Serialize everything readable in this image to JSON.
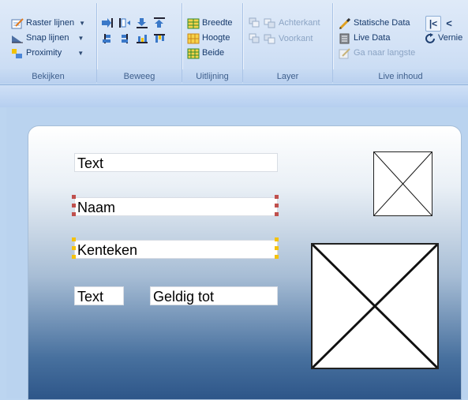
{
  "ribbon": {
    "groups": {
      "bekijken": {
        "label": "Bekijken",
        "raster": "Raster lijnen",
        "snap": "Snap lijnen",
        "proximity": "Proximity"
      },
      "beweeg": {
        "label": "Beweeg"
      },
      "uitlijning": {
        "label": "Uitlijning",
        "breedte": "Breedte",
        "hoogte": "Hoogte",
        "beide": "Beide"
      },
      "layer": {
        "label": "Layer",
        "achterkant": "Achterkant",
        "voorkant": "Voorkant"
      },
      "live": {
        "label": "Live inhoud",
        "statische": "Statische Data",
        "livedata": "Live Data",
        "ganaar": "Ga naar langste",
        "vernieuw": "Vernie"
      }
    }
  },
  "card": {
    "field_text1": "Text",
    "field_naam": "Naam",
    "field_kenteken": "Kenteken",
    "field_text2": "Text",
    "field_geldig": "Geldig tot"
  },
  "colors": {
    "handle_red": "#c0504d",
    "handle_yellow": "#f4c20d",
    "ribbon_text": "#15396b"
  }
}
